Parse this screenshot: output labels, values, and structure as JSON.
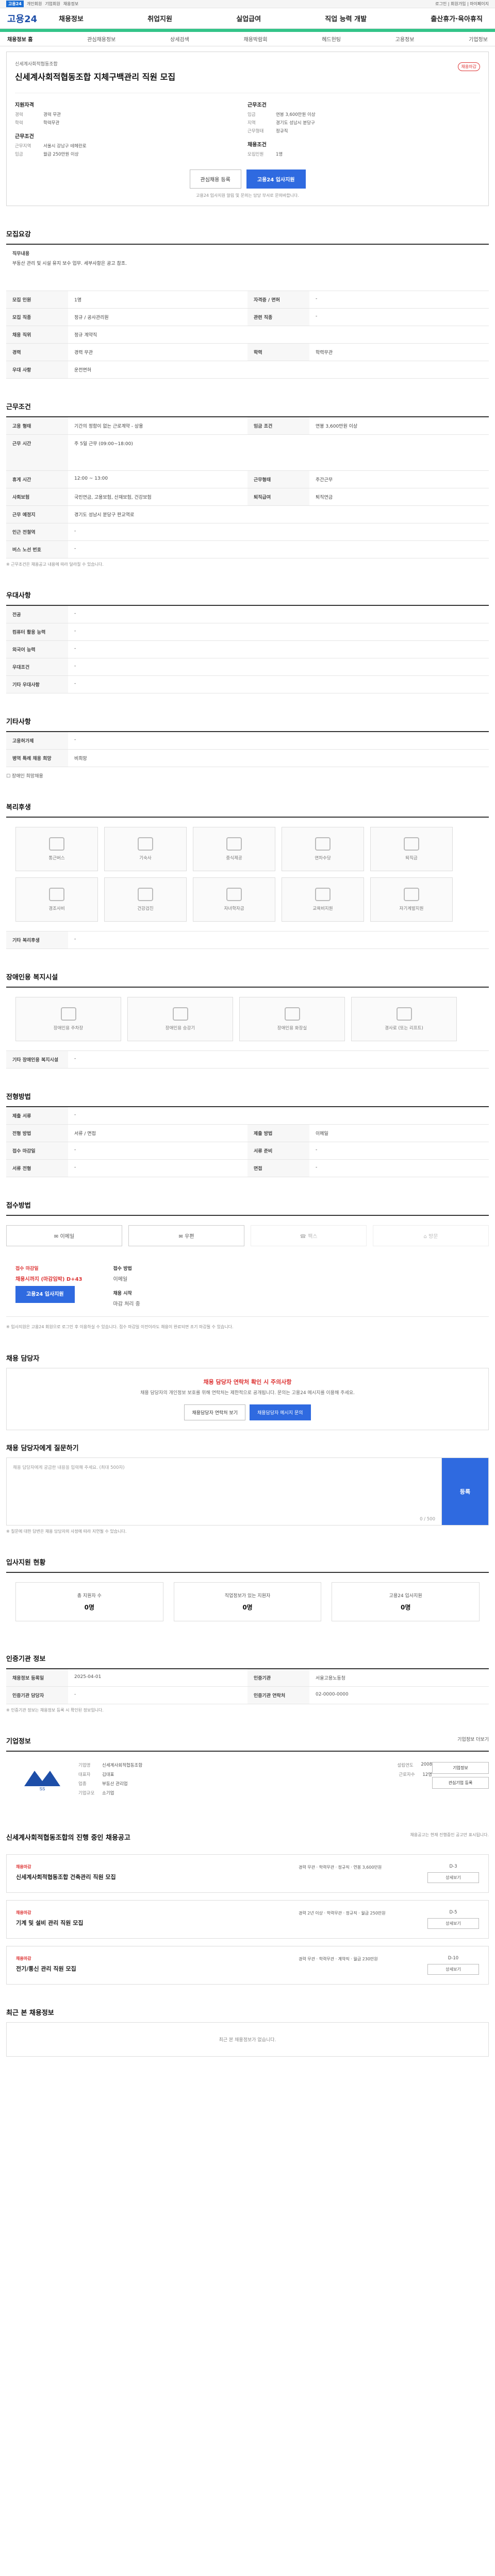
{
  "topbar": {
    "logo": "고용24",
    "items": [
      "개인회원",
      "기업회원",
      "채용정보"
    ],
    "right": "로그인 | 회원가입 | 마이페이지"
  },
  "header": {
    "logo": "고용24",
    "menus": [
      "채용정보",
      "취업지원",
      "실업급여",
      "직업 능력 개발",
      "출산휴가·육아휴직"
    ]
  },
  "subtab": {
    "items": [
      "채용정보 홈",
      "관심채용정보",
      "상세검색",
      "채용박람회",
      "헤드헌팅",
      "고용정보",
      "기업정보"
    ]
  },
  "job": {
    "company": "신세계사회적협동조합",
    "title": "신세계사회적협동조합 지체구백관리 직원 모집",
    "tag": "채용마감",
    "left": {
      "h": "지원자격",
      "rows": [
        {
          "k": "경력",
          "v": "경력 무관"
        },
        {
          "k": "학력",
          "v": "학력무관"
        }
      ],
      "h2": "근무조건",
      "rows2": [
        {
          "k": "근무지역",
          "v": "서울시 강남구 테헤란로"
        },
        {
          "k": "임금",
          "v": "월급 250만원 이상"
        }
      ]
    },
    "right": {
      "h": "근무조건",
      "rows": [
        {
          "k": "임금",
          "v": "연봉 3,600만원 이상"
        },
        {
          "k": "지역",
          "v": "경기도 성남시 분당구"
        },
        {
          "k": "근무형태",
          "v": "정규직"
        }
      ],
      "h2": "채용조건",
      "rows2": [
        {
          "k": "모집인원",
          "v": "1명"
        }
      ]
    },
    "btn_save": "관심채용 등록",
    "btn_apply": "고용24 입사지원",
    "note": "고용24 입사지원 알림 및 문의는 담당 부서로 문의바랍니다."
  },
  "recruit": {
    "h": "모집요강",
    "job_desc_label": "직무내용",
    "job_desc": "부동산 관리 및 시설 유지 보수 업무. 세부사항은 공고 참조.",
    "rows": [
      {
        "th": "모집 인원",
        "td": "1명",
        "th2": "자격증 / 면허",
        "td2": "-"
      },
      {
        "th": "모집 직종",
        "td": "정규 / 공사관리원",
        "th2": "관련 직종",
        "td2": "-"
      },
      {
        "th": "채용 직위",
        "td": "정규 계약직",
        "th2": "",
        "td2": ""
      },
      {
        "th": "경력",
        "td": "경력 무관",
        "th2": "학력",
        "td2": "학력무관"
      },
      {
        "th": "우대 사항",
        "td": "운전면허",
        "th2": "",
        "td2": ""
      }
    ]
  },
  "condition": {
    "h": "근무조건",
    "rows": [
      {
        "th": "고용 형태",
        "td": "기간의 정함이 없는 근로계약 - 상용",
        "th2": "임금 조건",
        "td2": "연봉 3,600만원 이상"
      },
      {
        "th": "근무 시간",
        "td": "주 5일 근무 (09:00~18:00)",
        "th2": "",
        "td2": ""
      },
      {
        "th": "휴게 시간",
        "td": "12:00 ~ 13:00",
        "th2": "근무형태",
        "td2": "주간근무"
      },
      {
        "th": "사회보험",
        "td": "국민연금, 고용보험, 산재보험, 건강보험",
        "th2": "퇴직급여",
        "td2": "퇴직연금"
      },
      {
        "th": "근무 예정지",
        "td": "경기도 성남시 분당구 판교역로",
        "th2": "",
        "td2": ""
      },
      {
        "th": "인근 전철역",
        "td": "-",
        "th2": "",
        "td2": ""
      },
      {
        "th": "버스 노선 번호",
        "td": "-",
        "th2": "",
        "td2": ""
      }
    ],
    "note": "※ 근무조건은 채용공고 내용에 따라 달라질 수 있습니다."
  },
  "welfare_info": {
    "h": "우대사항",
    "rows": [
      {
        "th": "전공",
        "td": "-"
      },
      {
        "th": "컴퓨터 활용 능력",
        "td": "-"
      },
      {
        "th": "외국어 능력",
        "td": "-"
      },
      {
        "th": "우대조건",
        "td": "-"
      },
      {
        "th": "기타 우대사항",
        "td": "-"
      }
    ]
  },
  "extra": {
    "h": "기타사항",
    "rows": [
      {
        "th": "고용허가제",
        "td": "-"
      },
      {
        "th": "병역 특례 채용 희망",
        "td": "비희망"
      }
    ],
    "check": "장애인 희망채용"
  },
  "welfare": {
    "h": "복리후생",
    "items": [
      "통근버스",
      "기숙사",
      "중식제공",
      "연차수당",
      "퇴직금",
      "경조사비",
      "건강검진",
      "자녀학자금",
      "교육비지원",
      "자기계발지원"
    ],
    "etc_label": "기타 복리후생",
    "etc": "-"
  },
  "facility": {
    "h": "장애인용 복지시설",
    "items": [
      "장애인용 주차장",
      "장애인용 승강기",
      "장애인용 화장실",
      "경사로 (또는 리프트)"
    ],
    "etc_label": "기타 장애인용 복지시설",
    "etc": "-"
  },
  "selection": {
    "h": "전형방법",
    "rows": [
      {
        "th": "제출 서류",
        "td": "-"
      },
      {
        "th": "전형 방법",
        "td": "서류 / 면접",
        "th2": "제출 방법",
        "td2": "이메일"
      },
      {
        "th": "접수 마감일",
        "td": "-",
        "th2": "서류 준비",
        "td2": "-"
      },
      {
        "th": "서류 전형",
        "td": "-",
        "th2": "면접",
        "td2": "-"
      }
    ]
  },
  "method": {
    "h": "접수방법",
    "items": [
      "이메일",
      "우편",
      "팩스",
      "방문"
    ],
    "off": [
      false,
      false,
      true,
      true
    ]
  },
  "apply": {
    "label1": "접수 마감일",
    "value1": "채용시까지 (마감임박) D+43",
    "label2": "접수 방법",
    "value2": "이메일",
    "label3": "채용 시작",
    "value3": "마감 처리 중",
    "btn": "고용24 입사지원",
    "notice": "※ 입사지원은 고용24 회원으로 로그인 후 이용하실 수 있습니다. 접수 마감일 이전이라도 채용이 완료되면 조기 마감될 수 있습니다."
  },
  "contact": {
    "h": "채용 담당자",
    "title": "채용 담당자 연락처 확인 시 주의사항",
    "desc": "채용 담당자의 개인정보 보호를 위해 연락처는 제한적으로 공개됩니다. 문의는 고용24 메시지를 이용해 주세요.",
    "btn1": "채용담당자 연락처 보기",
    "btn2": "채용담당자 메시지 문의"
  },
  "qna": {
    "h": "채용 담당자에게 질문하기",
    "placeholder": "채용 담당자에게 궁금한 내용을 입력해 주세요. (최대 500자)",
    "count": "0 / 500",
    "submit": "등록",
    "notes": "※ 질문에 대한 답변은 채용 담당자의 사정에 따라 지연될 수 있습니다."
  },
  "stats": {
    "h": "입사지원 현황",
    "items": [
      {
        "l": "총 지원자 수",
        "n": "0명"
      },
      {
        "l": "직업정보가 있는 지원자",
        "n": "0명"
      },
      {
        "l": "고용24 입사지원",
        "n": "0명"
      }
    ]
  },
  "reginfo": {
    "h": "인증기관 정보",
    "rows": [
      {
        "th": "채용정보 등록일",
        "td": "2025-04-01",
        "th2": "인증기관",
        "td2": "서울고용노동청"
      },
      {
        "th": "인증기관 담당자",
        "td": "-",
        "th2": "인증기관 연락처",
        "td2": "02-0000-0000"
      }
    ],
    "note": "※ 인증기관 정보는 채용정보 등록 시 확인된 정보입니다."
  },
  "company": {
    "h": "기업정보",
    "link": "기업정보 더보기",
    "logo": "SS",
    "name_label": "기업명",
    "name": "신세계사회적협동조합",
    "ceo_label": "대표자",
    "ceo": "김대표",
    "type_label": "업종",
    "type": "부동산 관리업",
    "size_label": "기업규모",
    "size": "소기업",
    "found_label": "설립연도",
    "found": "2008",
    "emp_label": "근로자수",
    "emp": "12명",
    "btn1": "기업정보",
    "btn2": "관심기업 등록"
  },
  "other_jobs": {
    "h": "신세계사회적협동조합의 진행 중인 채용공고",
    "note": "채용공고는 현재 진행중인 공고만 표시됩니다.",
    "cards": [
      {
        "c": "채용마감",
        "t": "신세계사회적협동조합 건축관리 직원 모집",
        "m": "경력 무관 · 학력무관 · 정규직 · 연봉 3,600만원",
        "r": "D-3",
        "b": "상세보기"
      },
      {
        "c": "채용마감",
        "t": "기계 및 설비 관리 직원 모집",
        "m": "경력 2년 이상 · 학력무관 · 정규직 · 월급 250만원",
        "r": "D-5",
        "b": "상세보기"
      },
      {
        "c": "채용마감",
        "t": "전기/통신 관리 직원 모집",
        "m": "경력 무관 · 학력무관 · 계약직 · 월급 230만원",
        "r": "D-10",
        "b": "상세보기"
      }
    ]
  },
  "recent": {
    "h": "최근 본 채용정보",
    "empty": "최근 본 채용정보가 없습니다."
  }
}
